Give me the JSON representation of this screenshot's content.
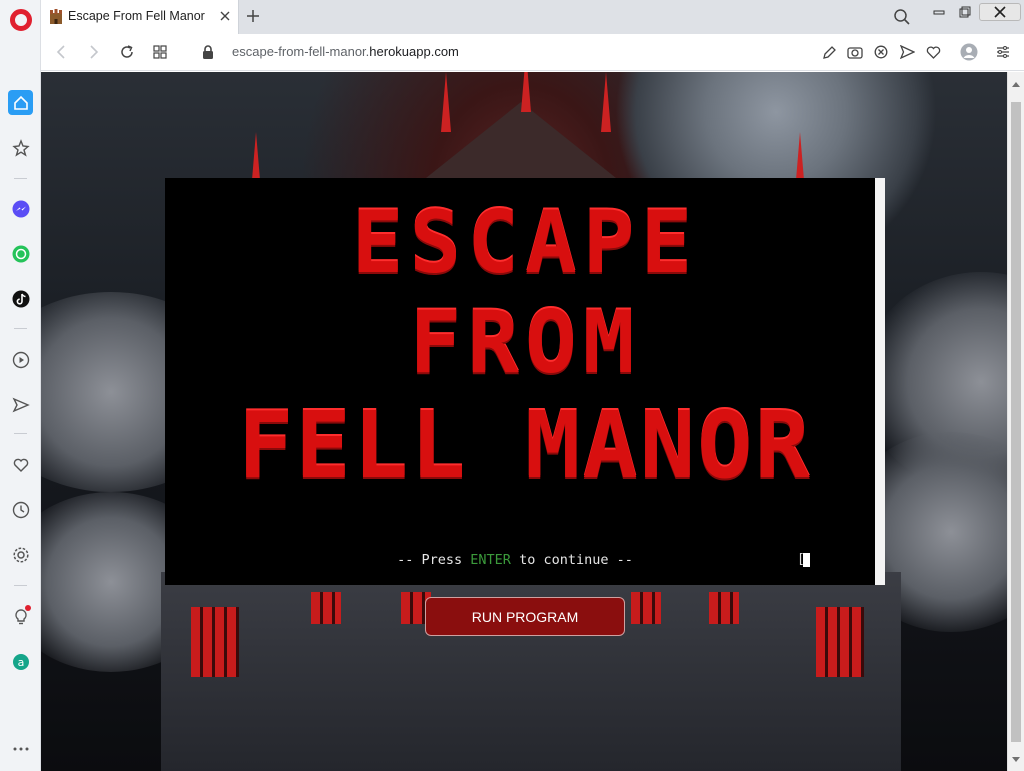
{
  "browser": {
    "tab_title": "Escape From Fell Manor",
    "url_prefix": "escape-from-fell-manor.",
    "url_domain": "herokuapp.com"
  },
  "sidebar": {
    "items": [
      "home-icon",
      "star-icon",
      "messenger-icon",
      "whatsapp-icon",
      "tiktok-icon",
      "player-icon",
      "send-icon",
      "heart-icon",
      "history-icon",
      "settings-icon",
      "lightbulb-icon",
      "aria-icon",
      "more-icon"
    ]
  },
  "terminal": {
    "banner_lines": [
      "ESCAPE",
      "FROM",
      "FELL MANOR"
    ],
    "prompt_prefix": "-- Press ",
    "prompt_key": "ENTER",
    "prompt_suffix": " to continue --",
    "cursor_char": "["
  },
  "page": {
    "run_button_label": "RUN PROGRAM"
  },
  "colors": {
    "accent": "#d80f0f",
    "button_bg": "#8a0e0e",
    "key_green": "#3b9a3b"
  }
}
